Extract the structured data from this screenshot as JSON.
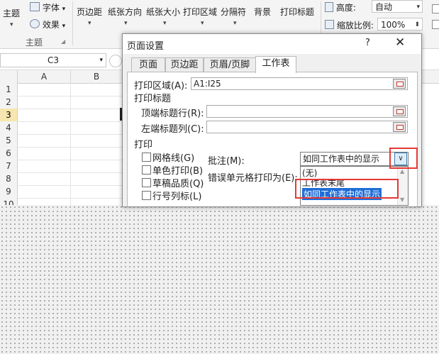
{
  "ribbon": {
    "themes_label": "主题",
    "fonts_label": "字体",
    "effects_label": "效果",
    "margins": "页边距",
    "orientation": "纸张方向",
    "size": "纸张大小",
    "print_area": "打印区域",
    "breaks": "分隔符",
    "background": "背景",
    "print_titles": "打印标题",
    "height_label": "高度:",
    "height_value": "自动",
    "scale_label": "缩放比例:",
    "scale_value": "100%",
    "group_themes": "主题"
  },
  "formula_bar": {
    "name_box": "C3"
  },
  "grid": {
    "columns": [
      "A",
      "B"
    ],
    "rows": [
      "1",
      "2",
      "3",
      "4",
      "5",
      "6",
      "7",
      "8",
      "9",
      "10"
    ]
  },
  "dialog": {
    "title": "页面设置",
    "help": "?",
    "close": "✕",
    "tabs": [
      "页面",
      "页边距",
      "页眉/页脚",
      "工作表"
    ],
    "print_area_label": "打印区域(A):",
    "print_area_value": "A1:I25",
    "print_titles_label": "打印标题",
    "top_rows_label": "顶端标题行(R):",
    "left_cols_label": "左端标题列(C):",
    "print_label": "打印",
    "gridlines": "网格线(G)",
    "black_white": "单色打印(B)",
    "draft": "草稿品质(Q)",
    "row_col_headings": "行号列标(L)",
    "comments_label": "批注(M):",
    "comments_value": "如同工作表中的显示",
    "errors_label": "错误单元格打印为(E):",
    "comments_options": [
      "(无)",
      "工作表末尾",
      "如同工作表中的显示"
    ]
  },
  "colors": {
    "highlight": "#e53935",
    "selection": "#1f6dd6"
  }
}
